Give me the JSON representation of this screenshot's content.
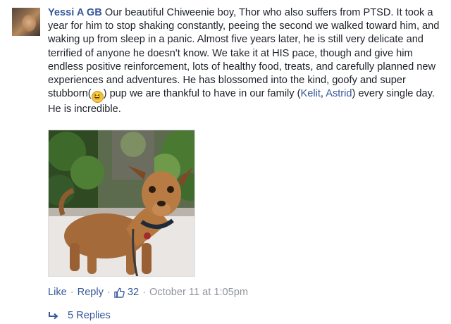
{
  "comment": {
    "author": "Yessi A GB",
    "text_before_emoji": " Our beautiful Chiweenie boy, Thor who also suffers from PTSD. It took a year for him to stop shaking constantly, peeing the second we walked toward him, and waking up from sleep in a panic. Almost five years later, he is still very delicate and terrified of anyone he doesn't know. We take it at HIS pace, though and give him endless positive reinforcement, lots of healthy food, treats, and carefully planned new experiences and adventures. He has blossomed into the kind, goofy and super stubborn(",
    "text_after_emoji": ") pup we are thankful to have in our family (",
    "tag_1": "Kelit",
    "tag_separator": ", ",
    "tag_2": "Astrid",
    "text_end": ") every single day. He is incredible."
  },
  "actions": {
    "like": "Like",
    "separator": "·",
    "reply": "Reply",
    "like_count": "32",
    "timestamp": "October 11 at 1:05pm"
  },
  "replies": {
    "label": "5 Replies"
  },
  "icons": {
    "avatar": "profile-photo",
    "photo": "dog-photo",
    "like": "thumbs-up-icon",
    "reply": "reply-arrow-icon",
    "emoji": "laughing-emoji-icon"
  },
  "colors": {
    "link": "#365899",
    "meta": "#90949c",
    "text": "#1d2129"
  }
}
